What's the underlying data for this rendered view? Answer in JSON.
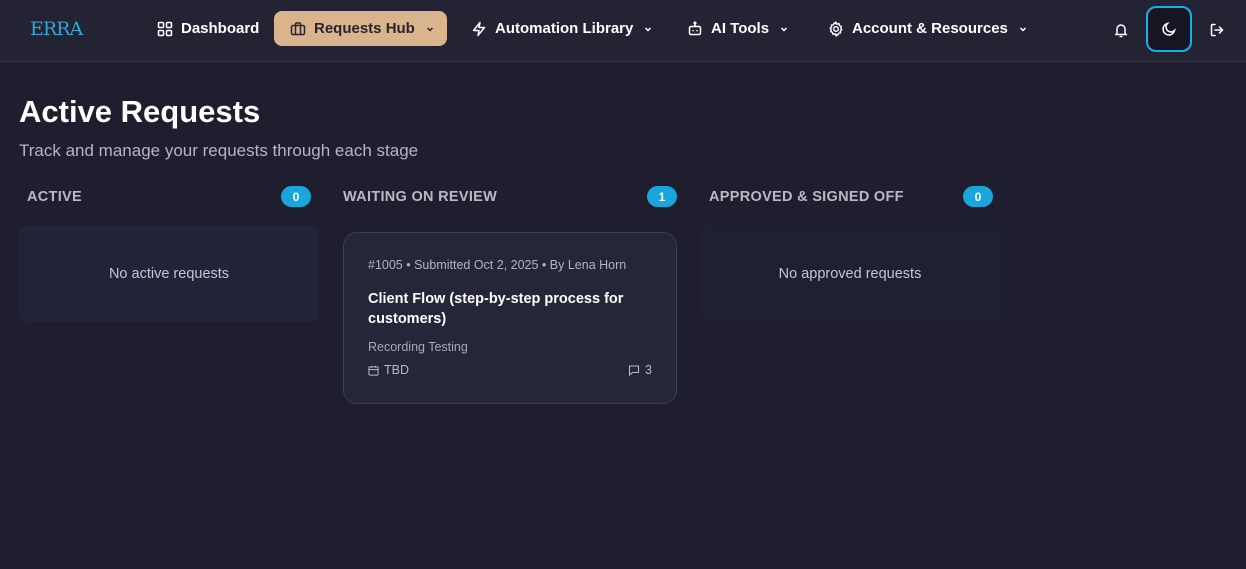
{
  "brand": {
    "logo_text": "ERRA"
  },
  "nav": {
    "dashboard": "Dashboard",
    "requests_hub": "Requests Hub",
    "automation_library": "Automation Library",
    "ai_tools": "AI Tools",
    "account_resources": "Account & Resources"
  },
  "page": {
    "title": "Active Requests",
    "subtitle": "Track and manage your requests through each stage"
  },
  "columns": [
    {
      "title": "ACTIVE",
      "count": "0",
      "empty_text": "No active requests"
    },
    {
      "title": "WAITING ON REVIEW",
      "count": "1"
    },
    {
      "title": "APPROVED & SIGNED OFF",
      "count": "0",
      "empty_text": "No approved requests"
    }
  ],
  "card": {
    "meta": "#1005 • Submitted Oct 2, 2025 • By Lena Horn",
    "title": "Client Flow (step-by-step process for customers)",
    "tag": "Recording Testing",
    "date": "TBD",
    "comments": "3"
  },
  "colors": {
    "background": "#1f1e2e",
    "navbar": "#232334",
    "accent_active_nav": "#d9b48c",
    "badge": "#1aa6dc",
    "focus_ring": "#1ab0e6"
  }
}
